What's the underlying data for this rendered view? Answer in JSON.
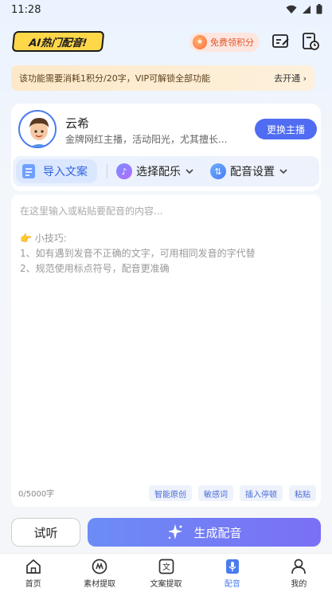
{
  "status_bar": {
    "time": "11:28"
  },
  "header": {
    "logo_text": "AI热门配音!",
    "points_label": "免费领积分",
    "icons": [
      "edit-icon",
      "history-icon"
    ]
  },
  "notice": {
    "text": "该功能需要消耗1积分/20字，VIP可解锁全部功能",
    "action": "去开通 ›"
  },
  "anchor": {
    "name": "云希",
    "description": "金牌网红主播，活动阳光，尤其擅长...",
    "swap_label": "更换主播"
  },
  "tabs": {
    "import_label": "导入文案",
    "music_label": "选择配乐",
    "voice_label": "配音设置"
  },
  "editor": {
    "placeholder": "在这里输入或粘贴要配音的内容...",
    "tips_title": "👉 小技巧:",
    "tip_1": "1、如有遇到发音不正确的文字，可用相同发音的字代替",
    "tip_2": "2、规范使用标点符号，配音更准确",
    "count": "0/5000字",
    "chips": [
      "智能原创",
      "敏感词",
      "插入停顿",
      "粘贴"
    ]
  },
  "actions": {
    "listen_label": "试听",
    "generate_label": "生成配音"
  },
  "nav": [
    {
      "label": "首页",
      "icon": "home-icon",
      "active": false
    },
    {
      "label": "素材提取",
      "icon": "material-icon",
      "active": false
    },
    {
      "label": "文案提取",
      "icon": "text-icon",
      "active": false
    },
    {
      "label": "配音",
      "icon": "dubbing-icon",
      "active": true
    },
    {
      "label": "我的",
      "icon": "profile-icon",
      "active": false
    }
  ],
  "colors": {
    "accent": "#4f6cf2",
    "notice_bg": "#fde9c9",
    "active_nav": "#4a7cf0"
  }
}
